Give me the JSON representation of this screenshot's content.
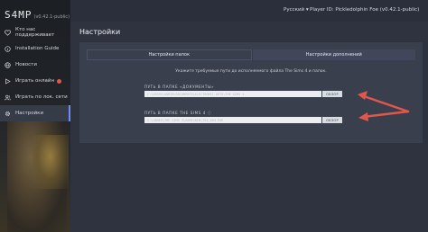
{
  "app": {
    "name": "S4MP",
    "version": "(v0.42.1-public)"
  },
  "sidebar": {
    "items": [
      {
        "label": "Кто нас поддерживает",
        "icon": "heart-icon"
      },
      {
        "label": "Installation Guide",
        "icon": "info-icon"
      },
      {
        "label": "Новости",
        "icon": "globe-icon"
      },
      {
        "label": "Играть онлайн",
        "icon": "play-icon",
        "badge": true
      },
      {
        "label": "Играть по лок. сети",
        "icon": "users-icon"
      },
      {
        "label": "Настройки",
        "icon": "gear-icon",
        "active": true
      }
    ]
  },
  "topbar": {
    "language": "Русский ▾",
    "player": "Player ID: Pickledolphin Foe (v0.42.1-public)"
  },
  "page": {
    "title": "Настройки",
    "tabs": [
      "Настройки папок",
      "Настройки дополнений"
    ],
    "hint": "Укажите требуемые пути до исполняемого файла The Sims 4 и папок.",
    "documents_label": "ПУТЬ В ПАПКЕ «ДОКУМЕНТЫ»",
    "documents_value": "C:\\USERS\\ADMIN\\DOCUMENTS\\ELECTRONIC ARTS\\THE SIMS 4",
    "sims_label": "ПУТЬ В ПАПКЕ THE SIMS 4 ⓘ",
    "sims_value": "C:\\GAMES\\THE SIMS 4\\GAME\\BIN\\TS4_X64.EXE",
    "browse_label": "ОБЗОР"
  },
  "colors": {
    "accent": "#6e8df0",
    "arrow": "#e2574c",
    "badge": "#e2574c"
  }
}
